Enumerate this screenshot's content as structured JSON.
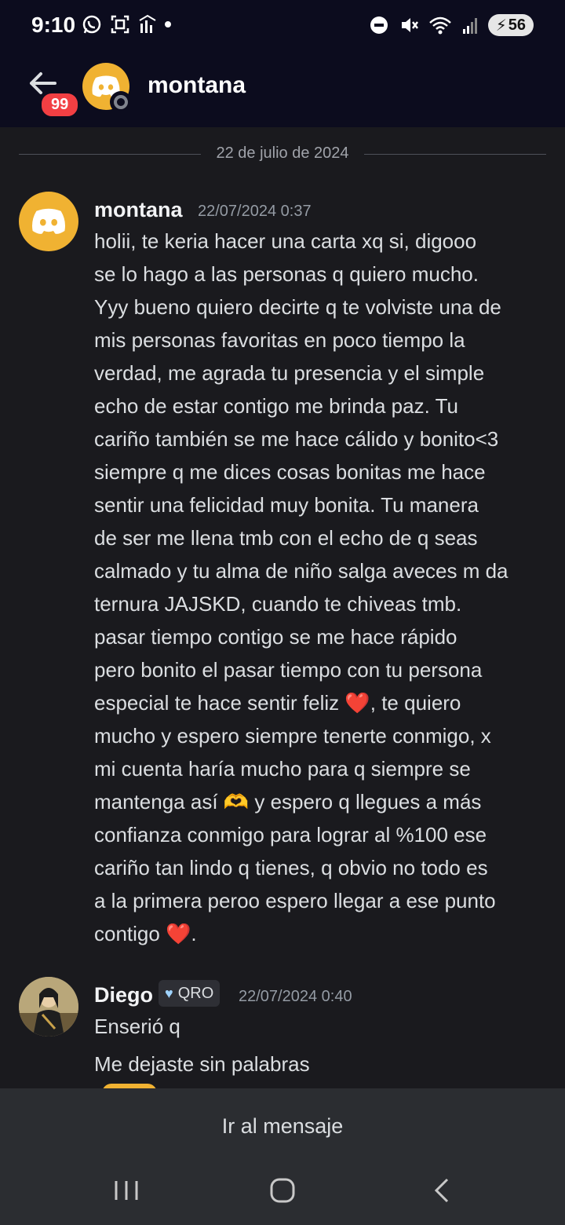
{
  "status_bar": {
    "time": "9:10",
    "battery": "56",
    "left_icons": [
      "whatsapp-icon",
      "scan-icon",
      "signal-activity-icon",
      "dot-icon"
    ],
    "right_icons": [
      "do-not-disturb-icon",
      "mute-icon",
      "wifi-icon",
      "cell-signal-icon"
    ]
  },
  "header": {
    "title": "montana",
    "unread_badge": "99",
    "status": "offline"
  },
  "divider": {
    "date": "22 de julio de 2024"
  },
  "messages": [
    {
      "author": "montana",
      "timestamp": "22/07/2024 0:37",
      "lines": [
        "holii, te keria hacer una carta xq si, digooo",
        "se lo hago a las personas q quiero mucho.",
        "Yyy bueno quiero decirte q te volviste una de",
        "mis personas favoritas en poco tiempo la",
        "verdad, me agrada tu presencia y el simple",
        "echo de estar contigo me brinda paz. Tu",
        "cariño también se me hace cálido y bonito<3",
        "siempre q me dices cosas bonitas me hace",
        "sentir una felicidad muy bonita. Tu manera",
        "de ser me llena tmb con el echo de q seas",
        "calmado y tu alma de niño salga aveces m da",
        "ternura JAJSKD, cuando te chiveas tmb.",
        "pasar tiempo contigo se me hace rápido",
        "pero bonito el pasar tiempo con tu persona",
        "especial te hace sentir feliz ❤️, te quiero",
        "mucho y espero siempre tenerte conmigo, x",
        "mi cuenta haría mucho para q siempre se",
        "mantenga así 🫶 y espero q llegues a más",
        "confianza conmigo para lograr al %100 ese",
        "cariño tan lindo q tienes, q obvio no todo es",
        "a la primera peroo espero llegar a ese punto",
        "contigo ❤️."
      ]
    },
    {
      "author": "Diego",
      "tag": "QRO",
      "timestamp": "22/07/2024 0:40",
      "lines": [
        "Enserió q",
        "Me dejaste sin palabras"
      ]
    }
  ],
  "jump_button": {
    "label": "Ir al mensaje"
  },
  "nav_bar": {
    "items": [
      "recents-icon",
      "home-icon",
      "back-icon"
    ]
  },
  "colors": {
    "background": "#1a1a1e",
    "header": "#0c0c1e",
    "discord_avatar": "#f0b232",
    "badge": "#f23f43",
    "bottom": "#2b2d31"
  }
}
